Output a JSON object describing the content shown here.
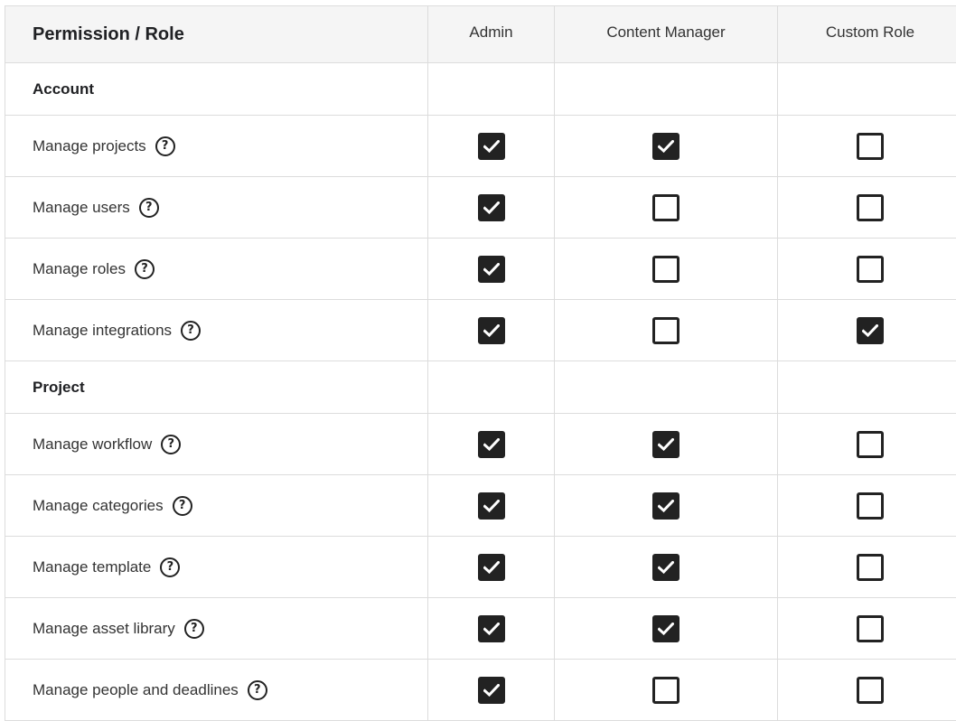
{
  "header": {
    "title": "Permission / Role",
    "roles": [
      "Admin",
      "Content Manager",
      "Custom Role"
    ]
  },
  "sections": [
    {
      "name": "Account",
      "permissions": [
        {
          "label": "Manage projects",
          "values": [
            true,
            true,
            false
          ]
        },
        {
          "label": "Manage users",
          "values": [
            true,
            false,
            false
          ]
        },
        {
          "label": "Manage roles",
          "values": [
            true,
            false,
            false
          ]
        },
        {
          "label": "Manage integrations",
          "values": [
            true,
            false,
            true
          ]
        }
      ]
    },
    {
      "name": "Project",
      "permissions": [
        {
          "label": "Manage workflow",
          "values": [
            true,
            true,
            false
          ]
        },
        {
          "label": "Manage categories",
          "values": [
            true,
            true,
            false
          ]
        },
        {
          "label": "Manage template",
          "values": [
            true,
            true,
            false
          ]
        },
        {
          "label": "Manage asset library",
          "values": [
            true,
            true,
            false
          ]
        },
        {
          "label": "Manage people and deadlines",
          "values": [
            true,
            false,
            false
          ]
        }
      ]
    }
  ],
  "icons": {
    "help": "question-circle-icon",
    "check": "checkmark-icon"
  },
  "colors": {
    "checkbox": "#222222",
    "header_bg": "#f5f5f5",
    "grid": "#dcdcdc"
  }
}
